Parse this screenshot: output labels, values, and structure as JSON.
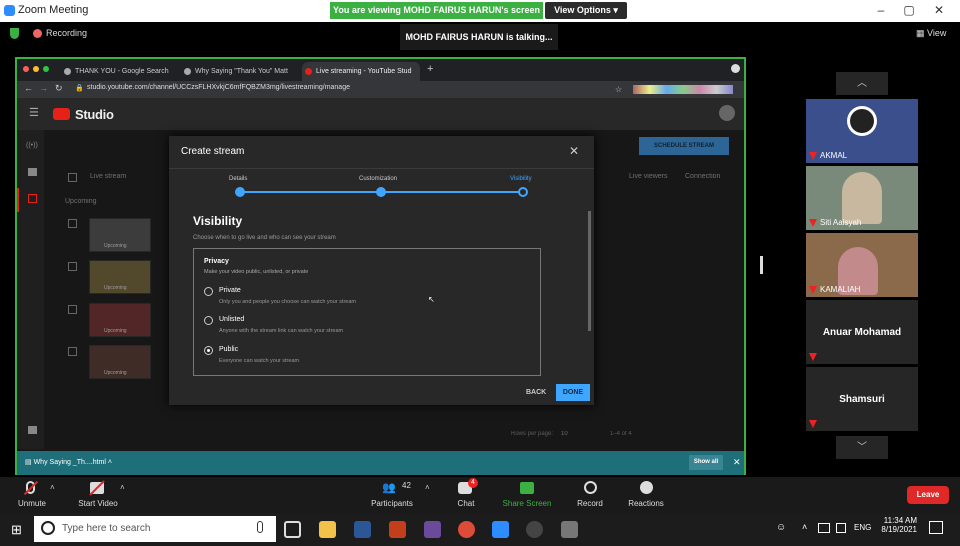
{
  "zoom": {
    "title": "Zoom Meeting",
    "share_banner": "You are viewing MOHD FAIRUS HARUN's screen",
    "view_options": "View Options",
    "recording": "Recording",
    "talking": "MOHD FAIRUS HARUN is talking...",
    "view_label": "View"
  },
  "browser": {
    "tabs": [
      {
        "label": "THANK YOU - Google Search"
      },
      {
        "label": "Why Saying \"Thank You\" Matt"
      },
      {
        "label": "Live streaming - YouTube Stud"
      }
    ],
    "url": "studio.youtube.com/channel/UCCzsFLHXvkjC6mfFQBZM3mg/livestreaming/manage"
  },
  "studio": {
    "logo_text": "Studio",
    "schedule_button": "SCHEDULE STREAM",
    "col_live_stream": "Live stream",
    "col_live_viewers": "Live viewers",
    "col_connection": "Connection",
    "section_upcoming": "Upcoming",
    "thumb_badge": "Upcoming",
    "rows_per_page_label": "Rows per page:",
    "rows_per_page": "10",
    "pagination": "1–4 of 4"
  },
  "modal": {
    "title": "Create stream",
    "steps": [
      "Details",
      "Customization",
      "Visibility"
    ],
    "visibility_title": "Visibility",
    "visibility_sub": "Choose when to go live and who can see your stream",
    "privacy_title": "Privacy",
    "privacy_desc": "Make your video public, unlisted, or private",
    "options": [
      {
        "label": "Private",
        "desc": "Only you and people you choose can watch your stream",
        "selected": false
      },
      {
        "label": "Unlisted",
        "desc": "Anyone with the stream link can watch your stream",
        "selected": false
      },
      {
        "label": "Public",
        "desc": "Everyone can watch your stream",
        "selected": true
      }
    ],
    "back": "BACK",
    "done": "DONE"
  },
  "download": {
    "item": "Why Saying _Th....html",
    "show_all": "Show all"
  },
  "participants": [
    {
      "name": "AKMAL",
      "type": "video"
    },
    {
      "name": "Siti Aaisyah",
      "type": "video"
    },
    {
      "name": "KAMALIAH",
      "type": "video"
    },
    {
      "name": "Anuar Mohamad",
      "type": "name"
    },
    {
      "name": "Shamsuri",
      "type": "name"
    }
  ],
  "controls": {
    "unmute": "Unmute",
    "start_video": "Start Video",
    "participants": "Participants",
    "participants_count": "42",
    "chat": "Chat",
    "chat_badge": "4",
    "share_screen": "Share Screen",
    "record": "Record",
    "reactions": "Reactions",
    "leave": "Leave"
  },
  "taskbar": {
    "search_placeholder": "Type here to search",
    "lang": "ENG",
    "time": "11:34 AM",
    "date": "8/19/2021"
  }
}
